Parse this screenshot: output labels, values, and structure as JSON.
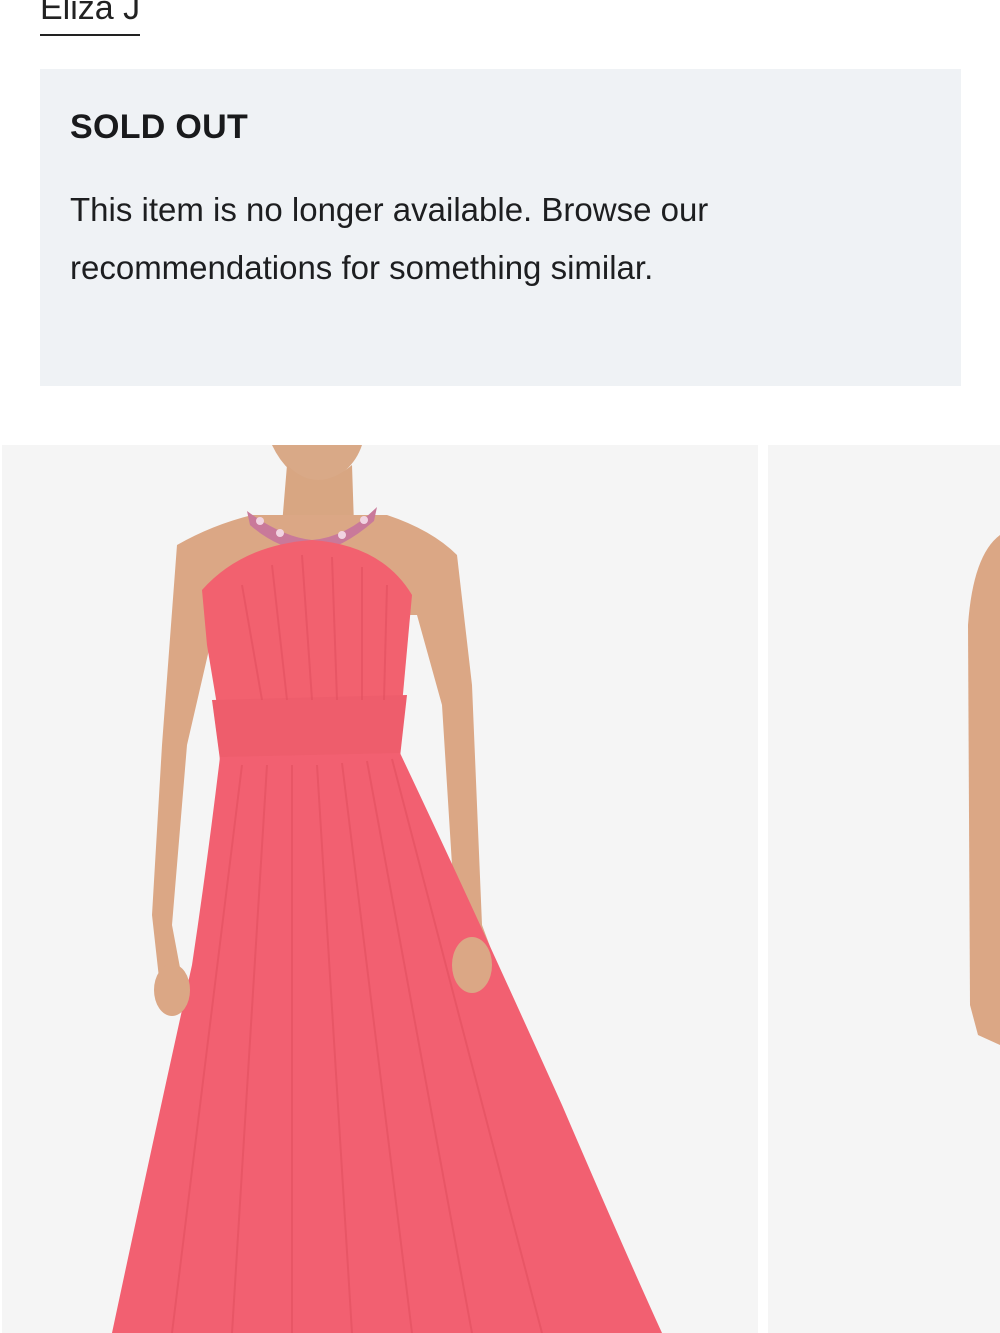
{
  "brand": {
    "name": "Eliza J"
  },
  "availability": {
    "status_title": "SOLD OUT",
    "message": "This item is no longer available. Browse our recommendations for something similar."
  },
  "carousel": {
    "images": [
      {
        "subject": "model wearing coral pink pleated halter maxi gown with jeweled neckline"
      },
      {
        "subject": "partially visible second product image"
      }
    ]
  },
  "colors": {
    "panel_background": "#eff2f5",
    "dress": "#f26071",
    "image_background": "#f5f5f5"
  }
}
